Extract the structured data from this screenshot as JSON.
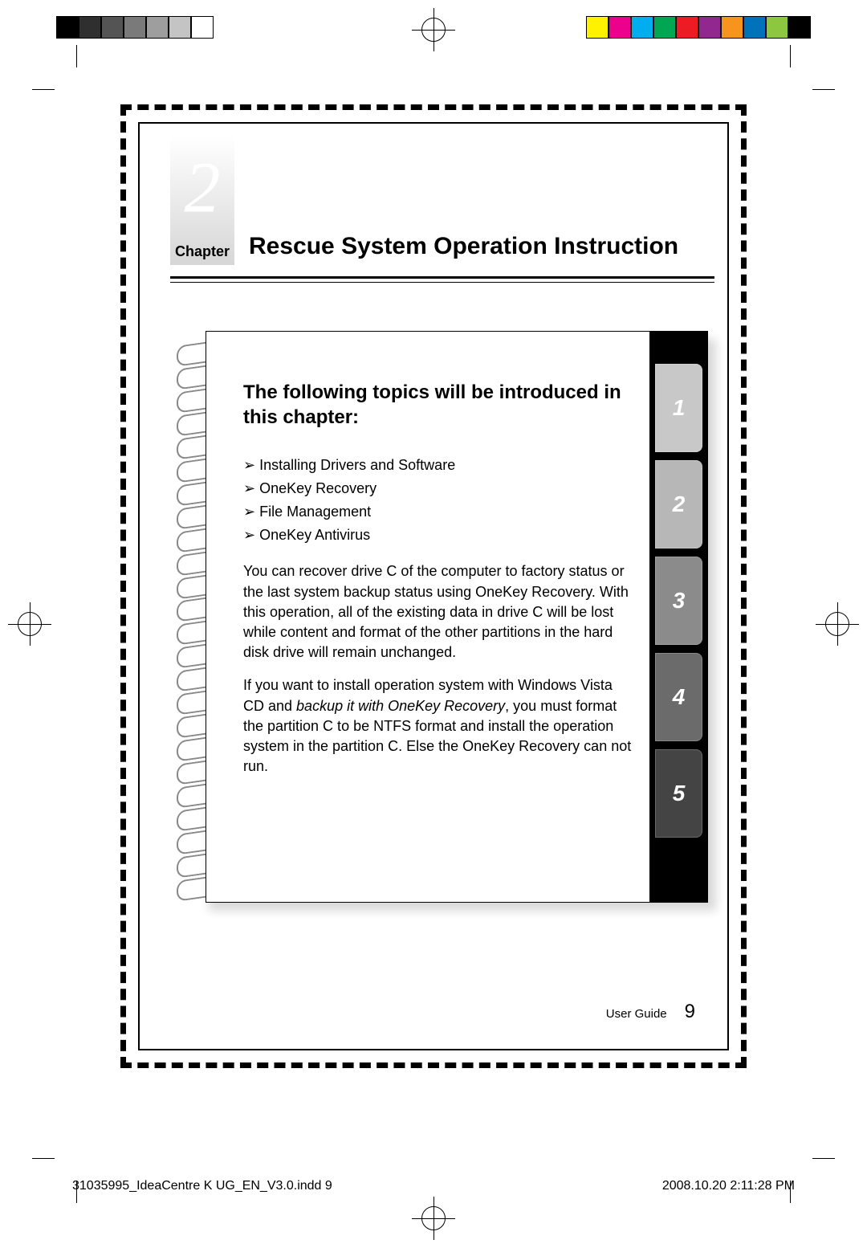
{
  "printer_bars": {
    "left": [
      "#000000",
      "#2f2f2f",
      "#545454",
      "#7a7a7a",
      "#9e9e9e",
      "#c4c4c4",
      "#ffffff"
    ],
    "right": [
      "#fff200",
      "#ec008c",
      "#00aeef",
      "#00a651",
      "#ed1c24",
      "#92278f",
      "#f7941d",
      "#0072bc",
      "#8dc63f",
      "#000000"
    ]
  },
  "chapter": {
    "number": "2",
    "label": "Chapter",
    "title": "Rescue System Operation Instruction"
  },
  "notebook": {
    "heading": "The following topics will be introduced in this chapter:",
    "topics": [
      "Installing Drivers and Software",
      "OneKey Recovery",
      "File Management",
      "OneKey Antivirus"
    ],
    "paragraph1": "You can recover drive C of the computer to factory status or the last system backup status using OneKey Recovery. With this operation, all of the existing data in drive C will be lost while content and format of the other partitions in the hard disk drive will remain unchanged.",
    "paragraph2_a": "If you want to install operation system with Windows Vista CD and ",
    "paragraph2_ital": "backup it with OneKey Recovery",
    "paragraph2_b": ", you must format the partition C to be NTFS format and install the operation system in the partition C. Else the OneKey Recovery can not run.",
    "tabs": [
      {
        "label": "1",
        "bg": "#c8c8c8"
      },
      {
        "label": "2",
        "bg": "#b7b7b7"
      },
      {
        "label": "3",
        "bg": "#8b8b8b"
      },
      {
        "label": "4",
        "bg": "#6b6b6b"
      },
      {
        "label": "5",
        "bg": "#444444"
      }
    ]
  },
  "footer": {
    "label": "User Guide",
    "page": "9"
  },
  "slug": {
    "file": "31035995_IdeaCentre K UG_EN_V3.0.indd   9",
    "timestamp": "2008.10.20   2:11:28 PM"
  }
}
